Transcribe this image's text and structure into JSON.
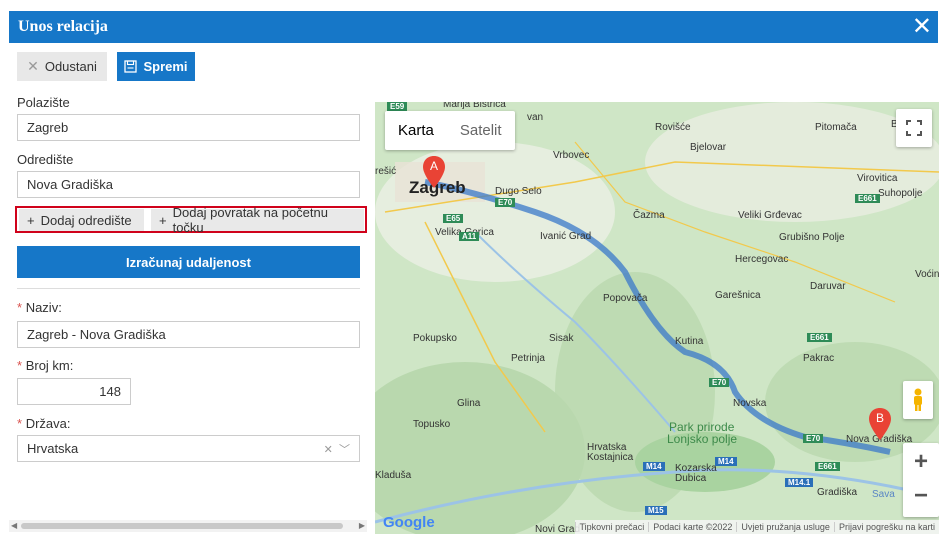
{
  "window": {
    "title": "Unos relacija",
    "close_icon": "close-icon"
  },
  "toolbar": {
    "cancel_label": "Odustani",
    "save_label": "Spremi"
  },
  "form": {
    "origin_label": "Polazište",
    "origin_value": "Zagreb",
    "destination_label": "Odredište",
    "destination_value": "Nova Gradiška",
    "add_destination": "Dodaj odredište",
    "add_return": "Dodaj povratak na početnu točku",
    "calculate": "Izračunaj udaljenost",
    "name_label": "Naziv:",
    "name_value": "Zagreb - Nova Gradiška",
    "km_label": "Broj km:",
    "km_value": "148",
    "country_label": "Država:",
    "country_value": "Hrvatska",
    "required_mark": "*"
  },
  "map": {
    "type_map": "Karta",
    "type_satellite": "Satelit",
    "marker_a": "A",
    "marker_b": "B",
    "google": "Google",
    "labels": {
      "zagreb": "Zagreb",
      "dugo_selo": "Dugo Selo",
      "vrbovec": "Vrbovec",
      "rovisce": "Rovišće",
      "bjelovar": "Bjelovar",
      "pitomaca": "Pitomača",
      "ba": "Ba",
      "virovitica": "Virovitica",
      "suhopolje": "Suhopolje",
      "cazma": "Čazma",
      "veliki_grdevac": "Veliki Grđevac",
      "grubisno_polje": "Grubišno Polje",
      "velika_gorica": "Velika Gorica",
      "ivanic_grad": "Ivanić Grad",
      "hercegovac": "Hercegovac",
      "vocin": "Voćin",
      "daruvar": "Daruvar",
      "popovaca": "Popovača",
      "garesnica": "Garešnica",
      "pokupsko": "Pokupsko",
      "sisak": "Sisak",
      "kutina": "Kutina",
      "pakrac": "Pakrac",
      "petrinja": "Petrinja",
      "glina": "Glina",
      "novska": "Novska",
      "topusko": "Topusko",
      "park": "Park prirode",
      "lonjsko": "Lonjsko polje",
      "nova_gradiska": "Nova Gradiška",
      "hrvatska_kostajnica": "Hrvatska Kostajnica",
      "kozarska_dubica": "Kozarska Dubica",
      "kladusa": "Kladuša",
      "gradiska": "Gradiška",
      "sava": "Sava",
      "resic": "rešić",
      "marija_bistrica": "Marija Bistrica",
      "van": "van"
    },
    "shields": {
      "e59": "E59",
      "e65": "E65",
      "a11": "A11",
      "e70a": "E70",
      "e70b": "E70",
      "e70c": "E70",
      "e661a": "E661",
      "e661b": "E661",
      "e661c": "E661",
      "m14a": "M14",
      "m14b": "M14",
      "m141": "M14.1",
      "m15": "M15"
    },
    "footer": [
      "Tipkovni prečaci",
      "Podaci karte ©2022",
      "Uvjeti pružanja usluge",
      "Prijavi pogrešku na karti"
    ],
    "bottom_left": "Novi Grad"
  }
}
